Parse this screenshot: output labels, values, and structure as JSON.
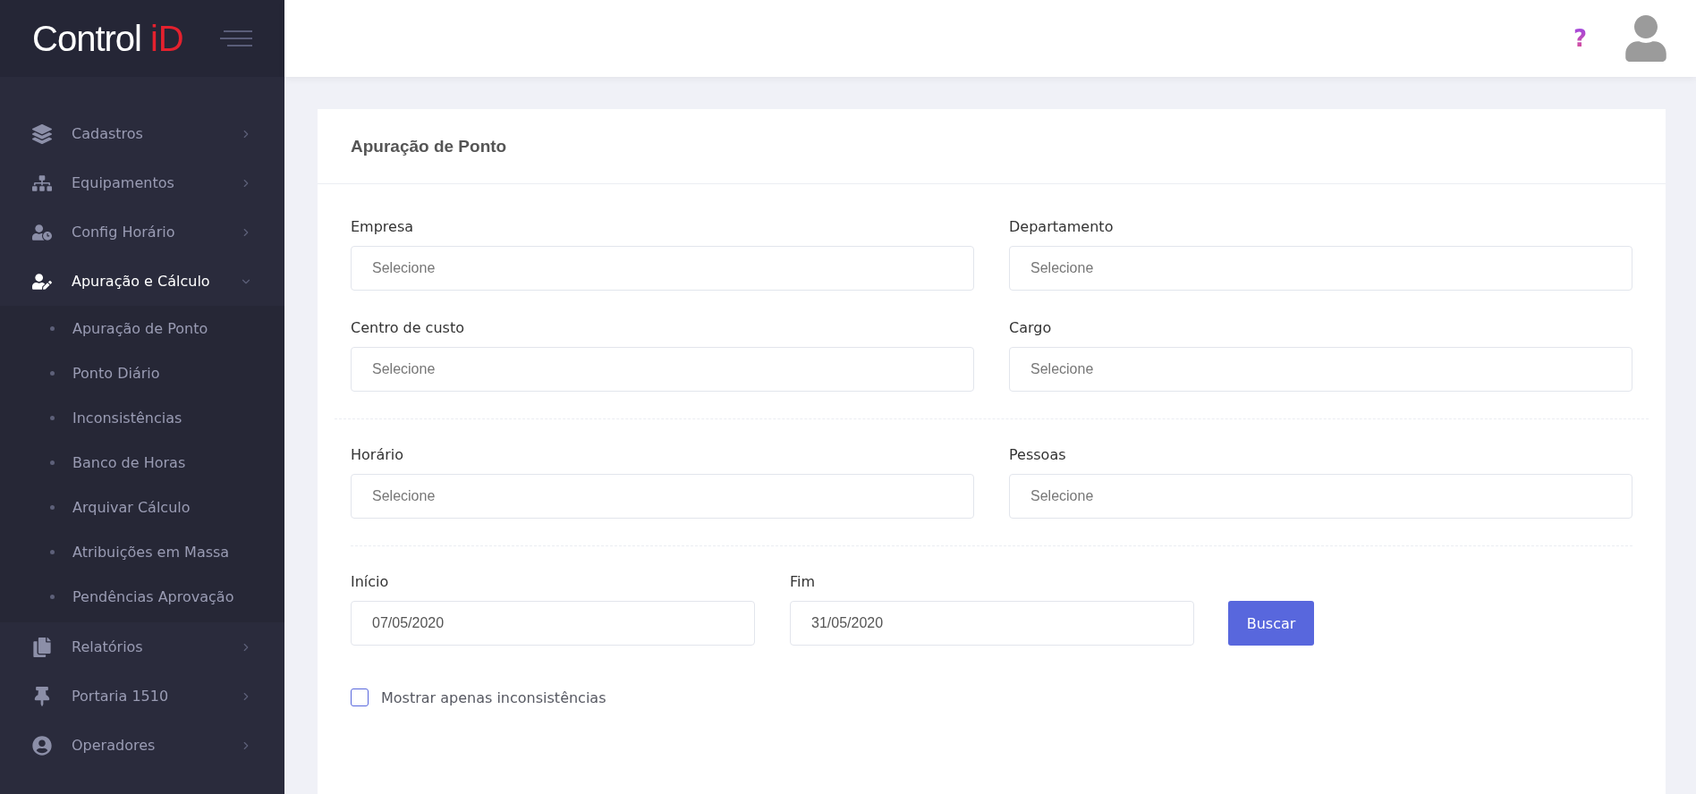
{
  "brand": {
    "name": "Control",
    "mark": "iD"
  },
  "topbar": {
    "help": "?"
  },
  "sidebar": {
    "items": [
      {
        "label": "Cadastros",
        "expanded": false
      },
      {
        "label": "Equipamentos",
        "expanded": false
      },
      {
        "label": "Config Horário",
        "expanded": false
      },
      {
        "label": "Apuração e Cálculo",
        "expanded": true,
        "children": [
          {
            "label": "Apuração de Ponto"
          },
          {
            "label": "Ponto Diário"
          },
          {
            "label": "Inconsistências"
          },
          {
            "label": "Banco de Horas"
          },
          {
            "label": "Arquivar Cálculo"
          },
          {
            "label": "Atribuições em Massa"
          },
          {
            "label": "Pendências Aprovação"
          }
        ]
      },
      {
        "label": "Relatórios",
        "expanded": false
      },
      {
        "label": "Portaria 1510",
        "expanded": false
      },
      {
        "label": "Operadores",
        "expanded": false
      }
    ]
  },
  "card": {
    "title": "Apuração de Ponto",
    "filter_groups": [
      [
        {
          "label": "Empresa",
          "placeholder": "Selecione"
        },
        {
          "label": "Departamento",
          "placeholder": "Selecione"
        },
        {
          "label": "Centro de custo",
          "placeholder": "Selecione"
        },
        {
          "label": "Cargo",
          "placeholder": "Selecione"
        }
      ],
      [
        {
          "label": "Horário",
          "placeholder": "Selecione"
        },
        {
          "label": "Pessoas",
          "placeholder": "Selecione"
        }
      ]
    ],
    "start": {
      "label": "Início",
      "value": "07/05/2020"
    },
    "end": {
      "label": "Fim",
      "value": "31/05/2020"
    },
    "search_button": "Buscar",
    "only_inconsistencies": {
      "label": "Mostrar apenas inconsistências",
      "checked": false
    }
  }
}
